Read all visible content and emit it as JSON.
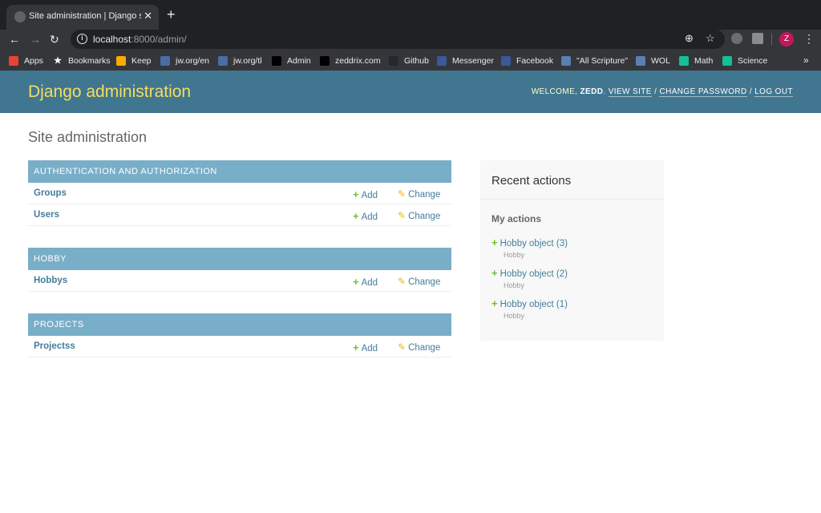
{
  "browser": {
    "tab_title": "Site administration | Django site",
    "tab_close": "✕",
    "new_tab": "+",
    "url_host": "localhost",
    "url_rest": ":8000/admin/",
    "profile_initial": "Z",
    "bookmarks_more": "»",
    "bookmarks": [
      {
        "label": "Apps",
        "icon": "apps-grid-icon",
        "color": "#ea4335"
      },
      {
        "label": "Bookmarks",
        "icon": "star-icon",
        "color": "#35363a"
      },
      {
        "label": "Keep",
        "icon": "keep-icon",
        "color": "#f9ab00"
      },
      {
        "label": "jw.org/en",
        "icon": "jw-icon",
        "color": "#4a6da7"
      },
      {
        "label": "jw.org/tl",
        "icon": "jw-icon",
        "color": "#4a6da7"
      },
      {
        "label": "Admin",
        "icon": "admin-icon",
        "color": "#000000"
      },
      {
        "label": "zeddrix.com",
        "icon": "zeddrix-icon",
        "color": "#000000"
      },
      {
        "label": "Github",
        "icon": "github-icon",
        "color": "#24292e"
      },
      {
        "label": "Messenger",
        "icon": "facebook-icon",
        "color": "#3b5998"
      },
      {
        "label": "Facebook",
        "icon": "facebook-icon",
        "color": "#3b5998"
      },
      {
        "label": "\"All Scripture\"",
        "icon": "book-icon",
        "color": "#5b7fb5"
      },
      {
        "label": "WOL",
        "icon": "book-icon",
        "color": "#5b7fb5"
      },
      {
        "label": "Math",
        "icon": "khan-icon",
        "color": "#14bf96"
      },
      {
        "label": "Science",
        "icon": "khan-icon",
        "color": "#14bf96"
      }
    ]
  },
  "header": {
    "branding": "Django administration",
    "welcome": "Welcome,",
    "username": "zedd",
    "view_site": "View site",
    "change_password": "Change password",
    "log_out": "Log out",
    "sep": "/"
  },
  "content": {
    "title": "Site administration",
    "add_label": "Add",
    "change_label": "Change",
    "modules": [
      {
        "caption": "Authentication and Authorization",
        "models": [
          "Groups",
          "Users"
        ]
      },
      {
        "caption": "Hobby",
        "models": [
          "Hobbys"
        ]
      },
      {
        "caption": "Projects",
        "models": [
          "Projectss"
        ]
      }
    ]
  },
  "recent": {
    "title": "Recent actions",
    "my_actions": "My actions",
    "items": [
      {
        "label": "Hobby object (3)",
        "type": "Hobby"
      },
      {
        "label": "Hobby object (2)",
        "type": "Hobby"
      },
      {
        "label": "Hobby object (1)",
        "type": "Hobby"
      }
    ]
  },
  "colors": {
    "header_bg": "#417690",
    "branding": "#f5dd5d",
    "caption_bg": "#79aec8",
    "link": "#447e9b",
    "add_icon": "#70bf2b",
    "change_icon": "#efb80b"
  }
}
